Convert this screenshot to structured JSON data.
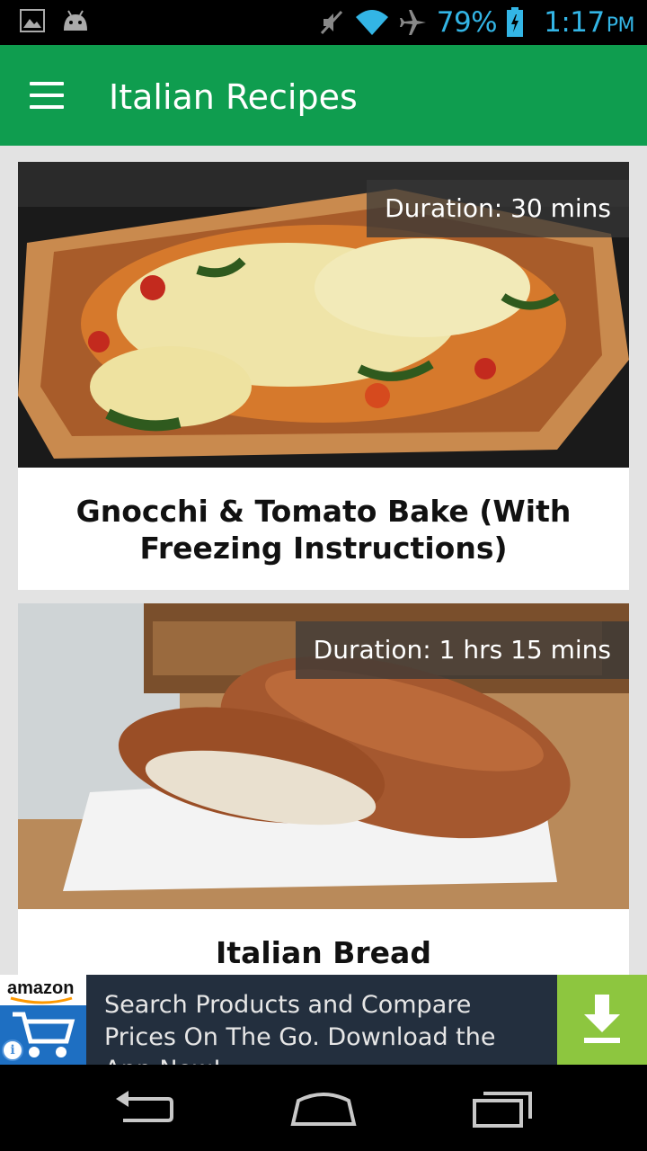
{
  "status_bar": {
    "battery": "79%",
    "time": "1:17",
    "ampm": "PM",
    "icons": [
      "image-icon",
      "android-icon",
      "mute-icon",
      "wifi-icon",
      "airplane-icon",
      "battery-icon"
    ]
  },
  "toolbar": {
    "title": "Italian Recipes",
    "color": "#0f9d4f"
  },
  "recipes": [
    {
      "title": "Gnocchi & Tomato Bake (With Freezing Instructions)",
      "duration": "Duration: 30 mins"
    },
    {
      "title": "Italian Bread",
      "duration": "Duration: 1 hrs 15 mins"
    }
  ],
  "ad": {
    "logo_text": "amazon",
    "text": "Search Products and Compare Prices On The Go. Download the App Now!",
    "accent": "#8dc63f"
  },
  "nav": {
    "icons": [
      "back-icon",
      "home-icon",
      "recents-icon"
    ]
  }
}
